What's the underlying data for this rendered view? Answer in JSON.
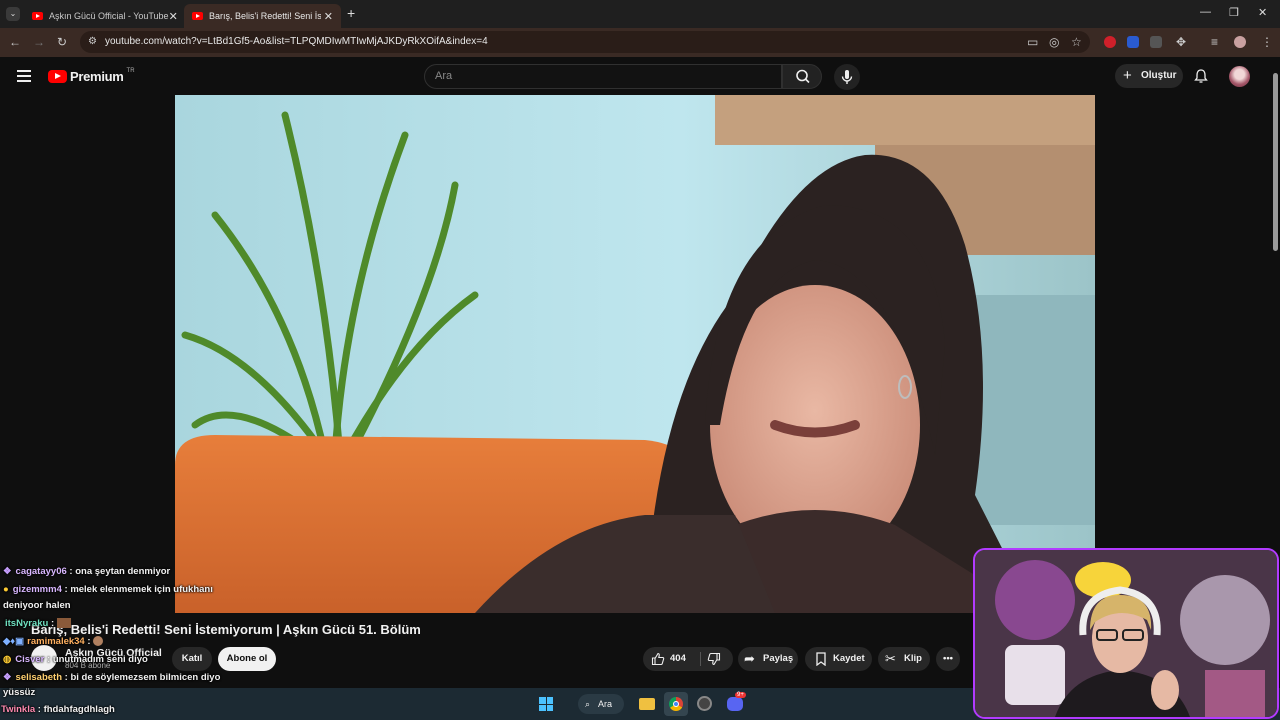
{
  "browser": {
    "tabs": [
      {
        "label": "Aşkın Gücü Official - YouTube",
        "active": false
      },
      {
        "label": "Barış, Belis'i Redetti! Seni İstemi",
        "active": true
      }
    ],
    "new_tab_glyph": "+",
    "close_glyph": "✕",
    "url": "youtube.com/watch?v=LtBd1Gf5-Ao&list=TLPQMDIwMTIwMjAJKDyRkXOifA&index=4"
  },
  "youtube": {
    "logo_text": "Premium",
    "country_code": "TR",
    "search_placeholder": "Ara",
    "create_label": "Oluştur",
    "accent_color": "#ff0000"
  },
  "video": {
    "title": "Barış, Belis'i Redetti! Seni İstemiyorum | Aşkın Gücü 51. Bölüm",
    "channel_name": "Aşkın Gücü Official",
    "subscribers": "804 B abone",
    "join_label": "Katıl",
    "subscribe_label": "Abone ol",
    "like_count": "404",
    "share_label": "Paylaş",
    "save_label": "Kaydet",
    "clip_label": "Klip"
  },
  "chat_overlay": [
    {
      "user": "cagatayy06",
      "message": "ona şeytan denmiyor"
    },
    {
      "user": "gizemmm4",
      "message": "melek elenmemek için ufukhanı"
    },
    {
      "user": "",
      "message": "deniyoor halen"
    },
    {
      "user": "itsNyraku",
      "message": ""
    },
    {
      "user": "ramimalek34",
      "message": ""
    },
    {
      "user": "Cisver",
      "message": "unutmadım seni diyo"
    },
    {
      "user": "selisabeth",
      "message": "bi de söylemezsem bilmicen diyo"
    },
    {
      "user": "",
      "message": "yüssüz"
    },
    {
      "user": "Twinkla",
      "message": "fhdahfagdhlagh"
    }
  ],
  "taskbar": {
    "search_label": "Ara",
    "discord_badge": "9+"
  }
}
